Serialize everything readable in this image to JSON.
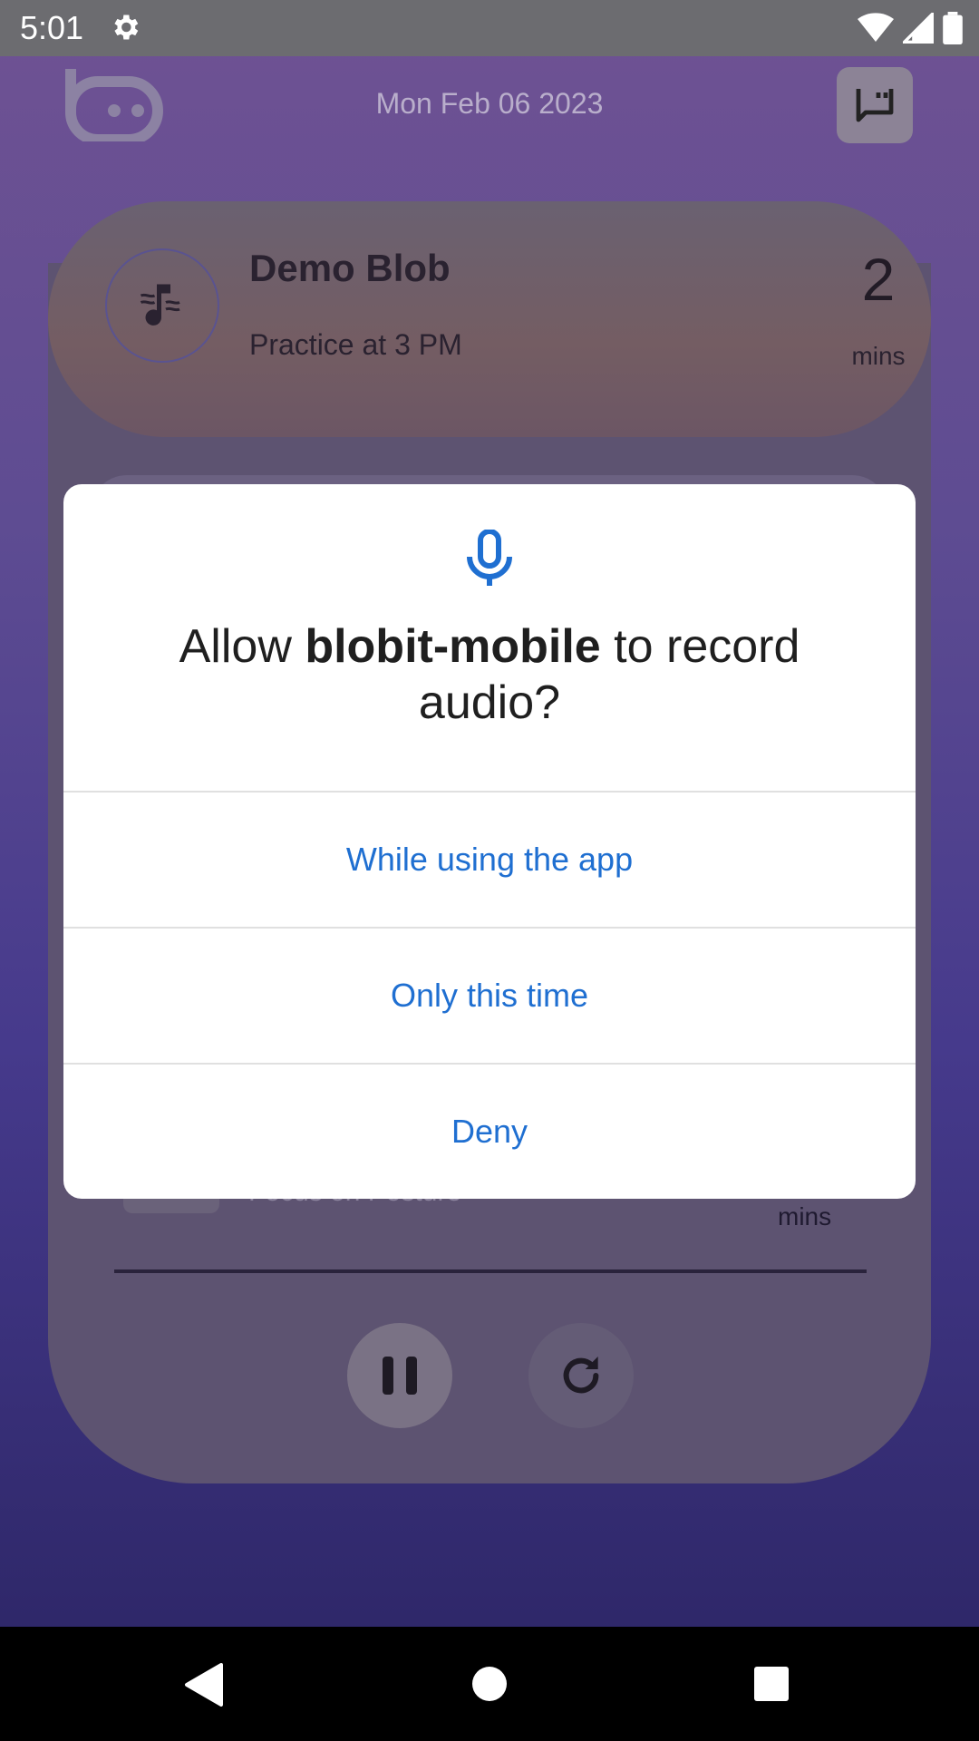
{
  "status_bar": {
    "time": "5:01"
  },
  "header": {
    "date": "Mon Feb 06 2023"
  },
  "blob_card": {
    "title": "Demo Blob",
    "subtitle": "Practice at 3 PM",
    "count": "2",
    "unit": "mins"
  },
  "behind_item": {
    "label": "Focus on Posture",
    "unit": "mins"
  },
  "dialog": {
    "title_prefix": "Allow ",
    "app_name": "blobit-mobile",
    "title_suffix": " to record audio?",
    "options": [
      "While using the app",
      "Only this time",
      "Deny"
    ]
  },
  "colors": {
    "accent": "#1f6fd1",
    "scrim": "#6c6c70"
  }
}
